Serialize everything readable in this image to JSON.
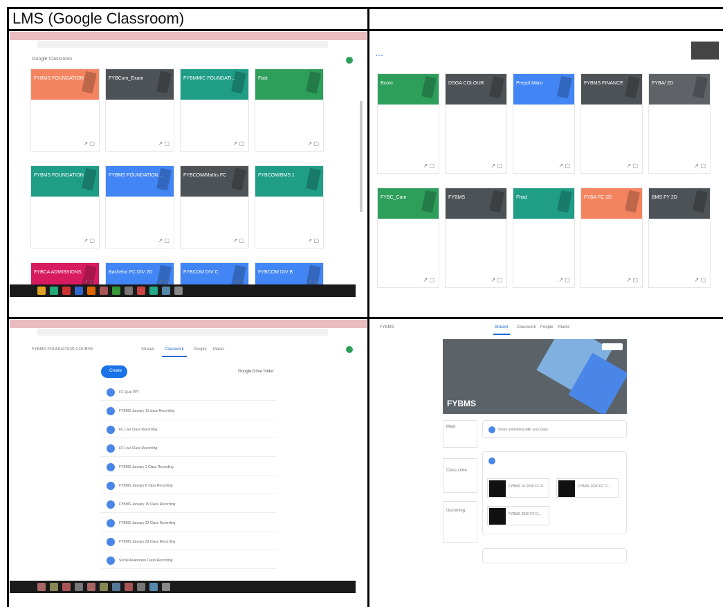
{
  "title": "LMS (Google Classroom)",
  "colors": {
    "orange": "#f4845f",
    "dark": "#4d5257",
    "teal": "#1f9d87",
    "green": "#2e9e5b",
    "blue": "#4285f4",
    "pink": "#d81b60",
    "grey": "#5f6368",
    "banner": "#5b6268"
  },
  "q1": {
    "app_title": "Google Classroom",
    "cards": [
      {
        "label": "FYBMS FOUNDATION",
        "color": "orange"
      },
      {
        "label": "FYBCom_Exam",
        "color": "dark"
      },
      {
        "label": "FYBMM/C FOUNDATI...",
        "color": "teal"
      },
      {
        "label": "Fast",
        "color": "green"
      },
      {
        "label": "FYBMS FOUNDATION",
        "color": "teal"
      },
      {
        "label": "FYBMS FOUNDATION...",
        "color": "blue"
      },
      {
        "label": "FYBCOM/Maths FC",
        "color": "dark"
      },
      {
        "label": "FYBCOM/BMS 1",
        "color": "teal"
      },
      {
        "label": "FYBCA ADMISSIONS",
        "color": "pink"
      },
      {
        "label": "Bachelor FC DIV 2D",
        "color": "blue"
      },
      {
        "label": "FYBCOM DIV C",
        "color": "blue"
      },
      {
        "label": "FYBCOM DIV B",
        "color": "blue"
      }
    ]
  },
  "q2": {
    "cards": [
      {
        "label": "Bcom",
        "color": "green"
      },
      {
        "label": "DSGA COLOUR",
        "color": "dark"
      },
      {
        "label": "Prepol Maro",
        "color": "blue"
      },
      {
        "label": "FYBMS FINANCE",
        "color": "dark"
      },
      {
        "label": "FYBA/ 2D",
        "color": "grey"
      },
      {
        "label": "FYBC_Cam",
        "color": "green"
      },
      {
        "label": "FYBMS",
        "color": "dark"
      },
      {
        "label": "Fhad",
        "color": "teal"
      },
      {
        "label": "FYBA FC 2D",
        "color": "orange"
      },
      {
        "label": "BMS FY 2D",
        "color": "dark"
      }
    ]
  },
  "q3": {
    "class_title": "FYBMS FOUNDATION COURSE",
    "tabs": [
      "Stream",
      "Classwork",
      "People",
      "Marks"
    ],
    "create_label": "Create",
    "drive_label": "Google Drive folder",
    "rows": [
      "FC Quiz PPT",
      "FYBMS January 12 class Recording",
      "FC Live Class Recording",
      "FC Live Class Recording",
      "FYBMS January 1 Class Recording",
      "FYBMS January 8 class Recording",
      "FYBMS January 15 Class Recording",
      "FYBMS January 22 Class Recording",
      "FYBMS January 29 Class Recording",
      "Social Awareness Class Recording"
    ]
  },
  "q4": {
    "class_name": "FYBMS",
    "tabs": [
      "Stream",
      "Classwork",
      "People",
      "Marks"
    ],
    "announce_placeholder": "Share something with your class",
    "attachments": [
      "FYBMS 10-2020 FC D...",
      "FYBMS 2020 FC D...",
      "FYBMS 2020 FC D..."
    ],
    "side": [
      "Meet",
      "Class code",
      "Upcoming"
    ]
  }
}
